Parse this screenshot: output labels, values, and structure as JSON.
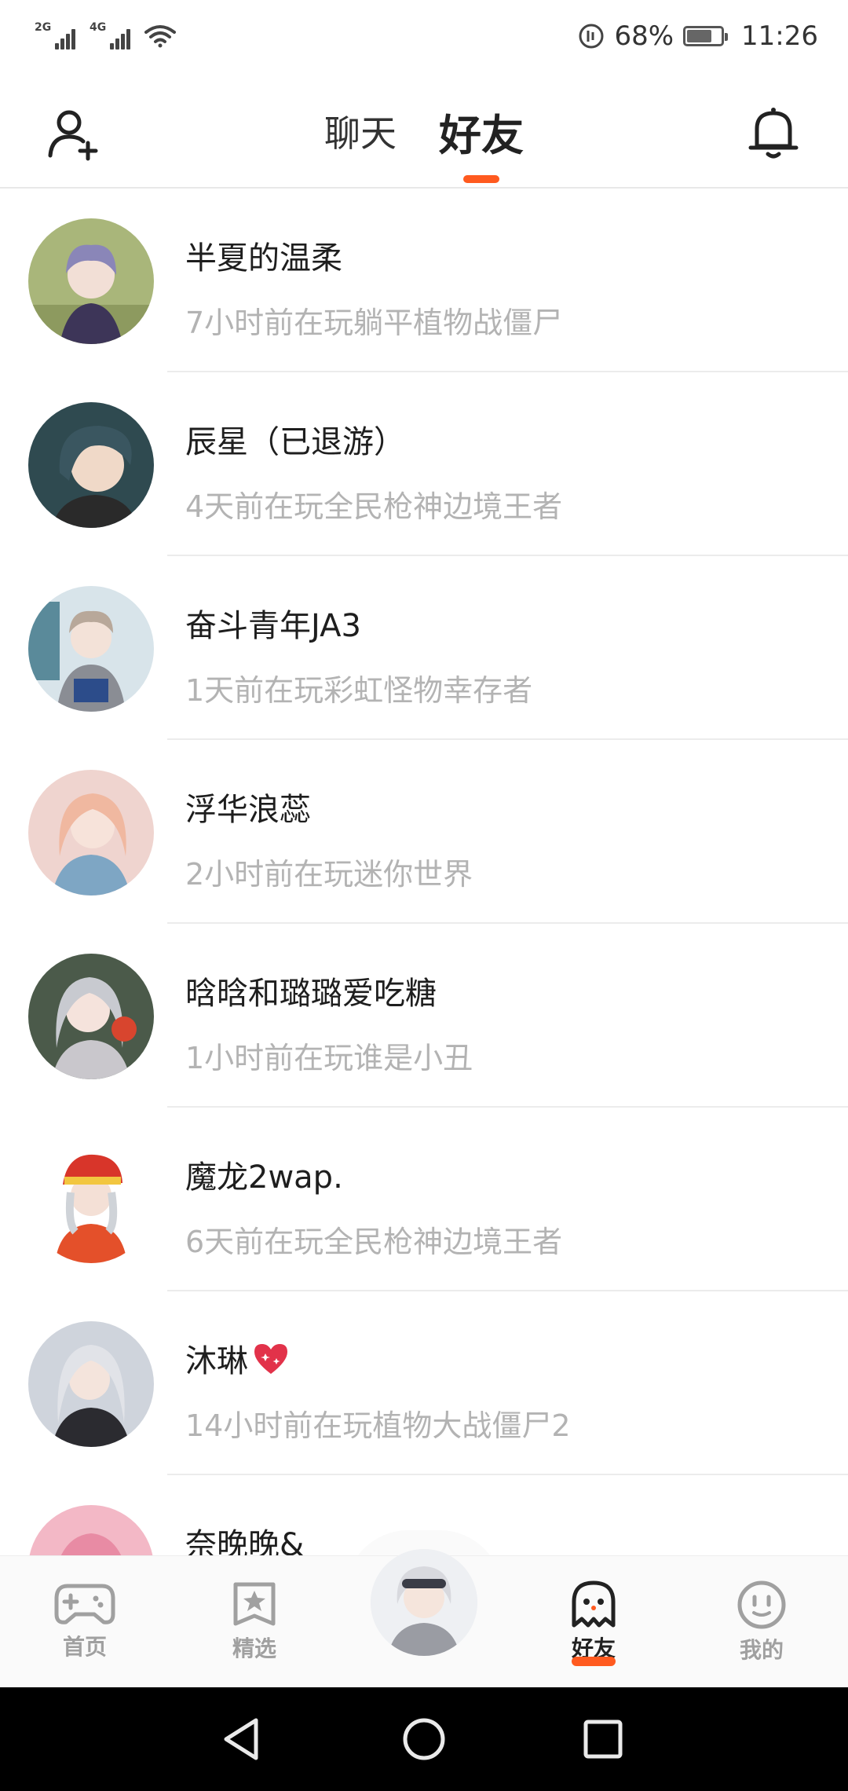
{
  "status_bar": {
    "signal1_label": "2G",
    "signal2_label": "4G",
    "battery_percent": "68%",
    "battery_level": 0.68,
    "time": "11:26"
  },
  "header": {
    "tabs": [
      {
        "label": "聊天",
        "active": false
      },
      {
        "label": "好友",
        "active": true
      }
    ],
    "add_friend_icon": "add-friend-icon",
    "bell_icon": "bell-icon"
  },
  "friends": [
    {
      "name": "半夏的温柔",
      "status": "7小时前在玩躺平植物战僵尸"
    },
    {
      "name": "辰星（已退游）",
      "status": "4天前在玩全民枪神边境王者"
    },
    {
      "name": "奋斗青年JA3",
      "status": "1天前在玩彩虹怪物幸存者"
    },
    {
      "name": "浮华浪蕊",
      "status": "2小时前在玩迷你世界"
    },
    {
      "name": "晗晗和璐璐爱吃糖",
      "status": "1小时前在玩谁是小丑"
    },
    {
      "name": "魔龙2wap.",
      "status": "6天前在玩全民枪神边境王者"
    },
    {
      "name": "沐琳",
      "status": "14小时前在玩植物大战僵尸2"
    },
    {
      "name": "奈晚晚&",
      "status": ""
    }
  ],
  "bottom_nav": {
    "items": [
      {
        "label": "首页",
        "icon": "gamepad-icon"
      },
      {
        "label": "精选",
        "icon": "star-bookmark-icon"
      },
      {
        "label": "好友",
        "icon": "ghost-icon",
        "active": true
      },
      {
        "label": "我的",
        "icon": "smiley-icon"
      }
    ]
  },
  "colors": {
    "accent": "#ff5a1f",
    "text_primary": "#1e1e1e",
    "text_secondary": "#b3b3b3",
    "nav_inactive": "#a0a0a0"
  }
}
